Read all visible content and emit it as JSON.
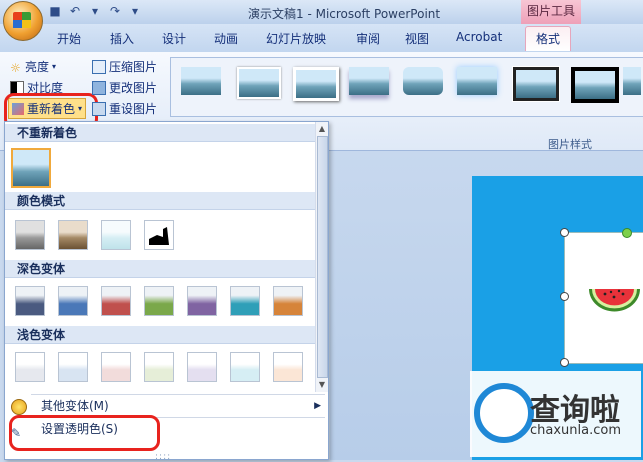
{
  "window": {
    "title": "演示文稿1 - Microsoft PowerPoint",
    "context_tool": "图片工具"
  },
  "ribbon_tabs": [
    "开始",
    "插入",
    "设计",
    "动画",
    "幻灯片放映",
    "审阅",
    "视图",
    "Acrobat",
    "格式"
  ],
  "active_tab": "格式",
  "adjust": {
    "brightness": "亮度",
    "contrast": "对比度",
    "recolor": "重新着色",
    "compress": "压缩图片",
    "change": "更改图片",
    "reset": "重设图片"
  },
  "picture_styles_label": "图片样式",
  "recolor_menu": {
    "no_recolor": "不重新着色",
    "color_modes": "颜色模式",
    "dark_variations": "深色变体",
    "light_variations": "浅色变体",
    "more_variations": "其他变体(M)",
    "set_transparent": "设置透明色(S)",
    "dark_colors": [
      "#4a5a80",
      "#4a78b8",
      "#c0504d",
      "#7aa84a",
      "#8064a2",
      "#2f9fb8",
      "#d6843a"
    ],
    "light_colors": [
      "#e6e8ee",
      "#d8e4f2",
      "#f2dcdb",
      "#e6eed8",
      "#e4dff0",
      "#d6eef4",
      "#fbe6d6"
    ]
  },
  "brand": {
    "name": "查询啦",
    "url": "chaxunla.com"
  },
  "colors": {
    "ribbon_bg": "#dfe9f7",
    "accent_red": "#e8231e",
    "slide_bg": "#1aa0e6",
    "brand_blue": "#1f88d6"
  }
}
